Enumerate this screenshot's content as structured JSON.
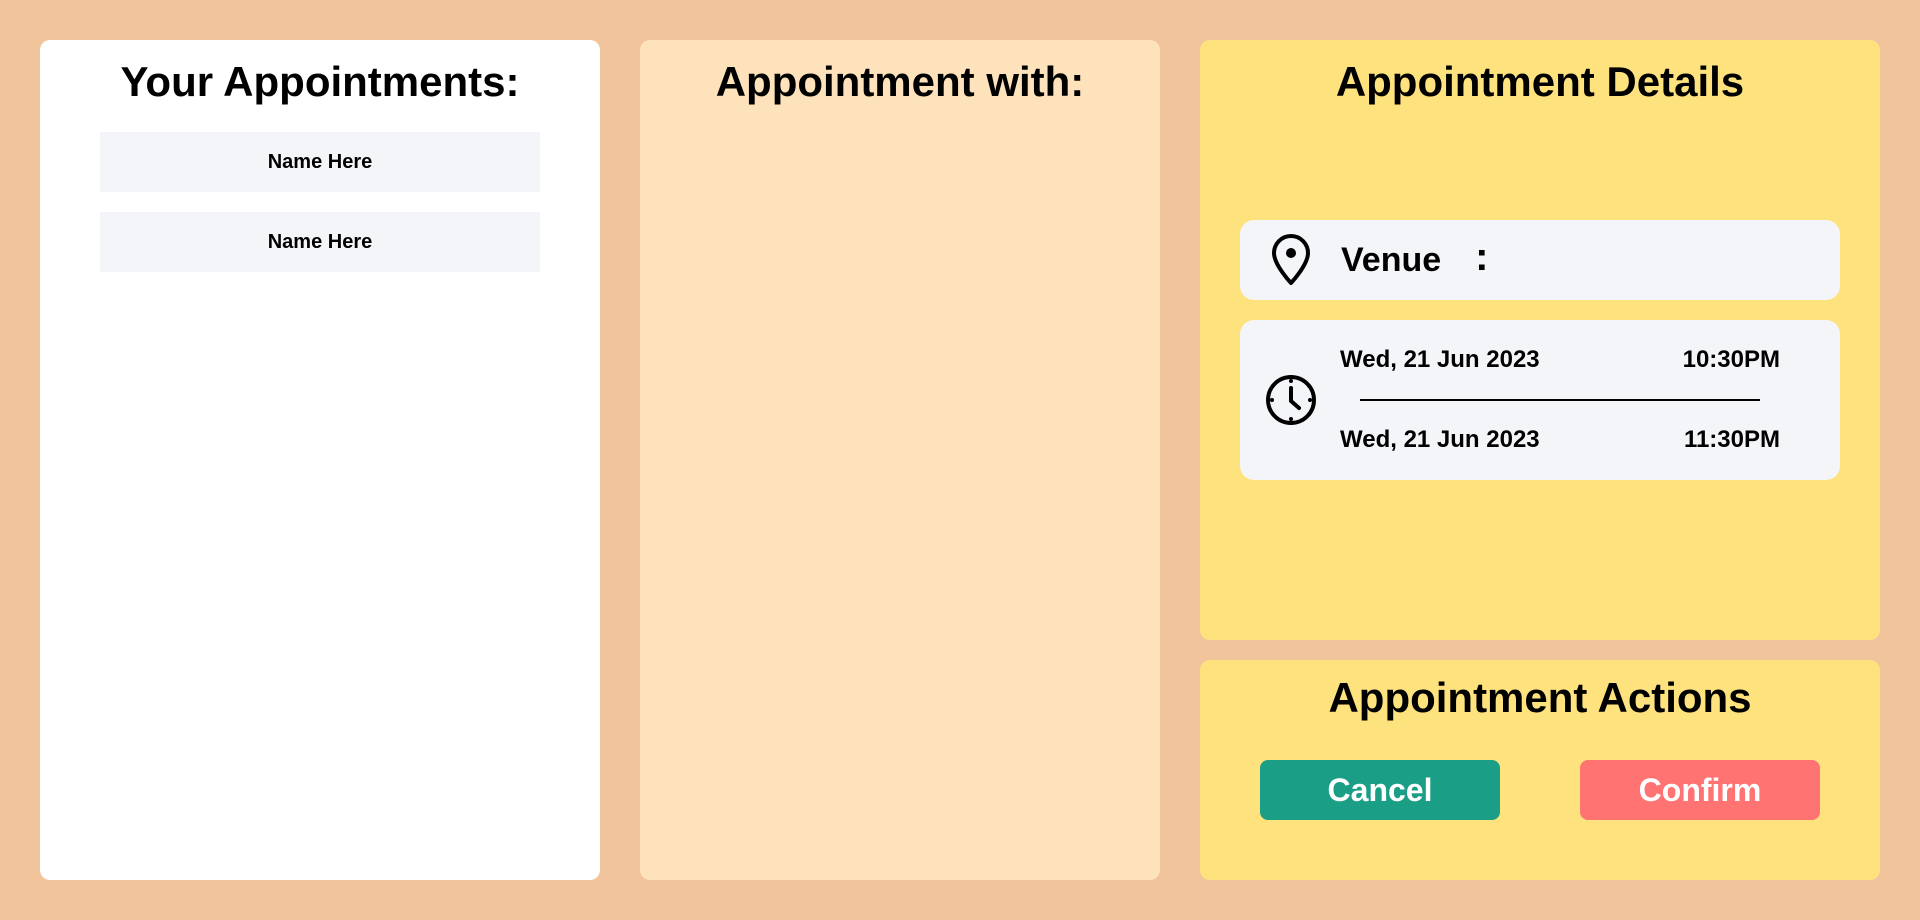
{
  "appointments_panel": {
    "title": "Your Appointments:",
    "items": [
      {
        "name": "Name Here"
      },
      {
        "name": "Name Here"
      }
    ]
  },
  "with_panel": {
    "title": "Appointment with:"
  },
  "details_panel": {
    "title": "Appointment Details",
    "venue": {
      "label": "Venue",
      "separator": ":",
      "icon": "map-pin-icon"
    },
    "time": {
      "icon": "clock-icon",
      "start_date": "Wed, 21 Jun 2023",
      "start_time": "10:30PM",
      "end_date": "Wed, 21 Jun 2023",
      "end_time": "11:30PM"
    }
  },
  "actions_panel": {
    "title": "Appointment Actions",
    "cancel_label": "Cancel",
    "confirm_label": "Confirm"
  },
  "colors": {
    "background": "#f1c49b",
    "list_panel": "#ffffff",
    "with_panel": "#fde2bb",
    "details_panel": "#fee27e",
    "card": "#f4f5f9",
    "cancel": "#1b9e86",
    "confirm": "#ff7373"
  }
}
